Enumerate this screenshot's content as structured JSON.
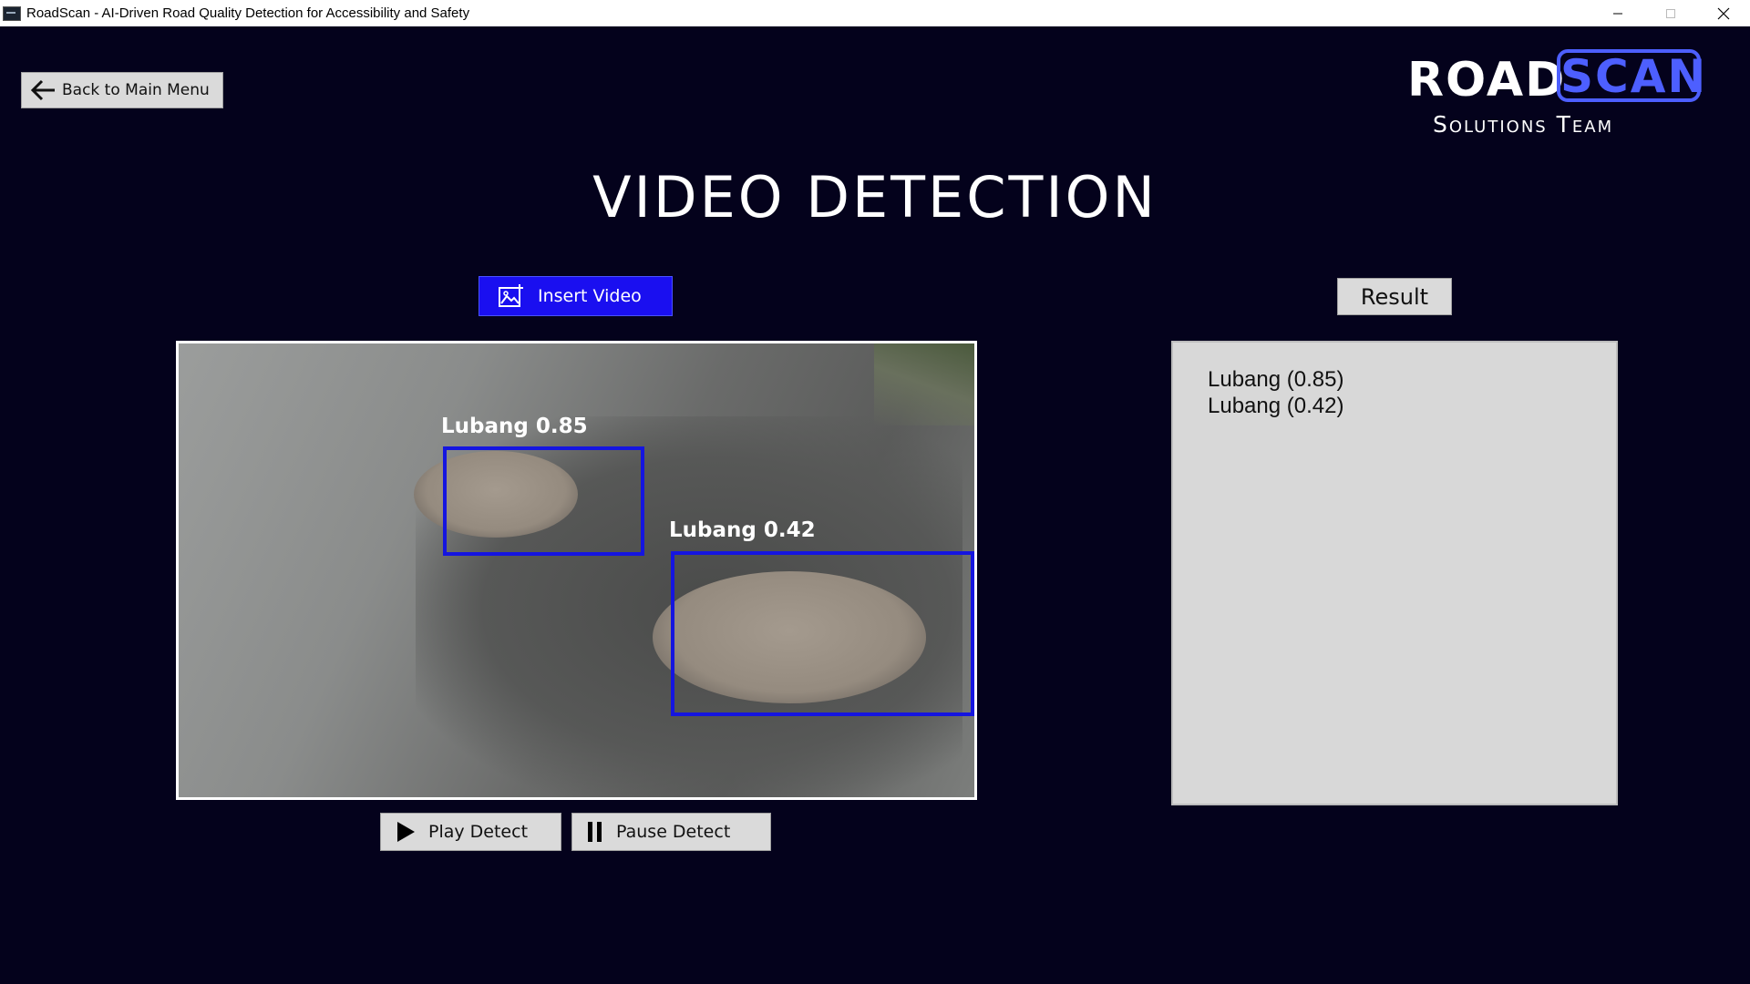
{
  "window": {
    "title": "RoadScan - AI-Driven Road Quality Detection for Accessibility and Safety"
  },
  "nav": {
    "back_label": "Back to Main Menu"
  },
  "logo": {
    "road": "ROAD",
    "scan": "SCAN",
    "subtitle": "Solutions Team"
  },
  "page": {
    "title": "VIDEO DETECTION"
  },
  "actions": {
    "insert_label": "Insert Video",
    "play_label": "Play Detect",
    "pause_label": "Pause Detect",
    "result_label": "Result"
  },
  "video": {
    "detections": [
      {
        "label": "Lubang 0.85"
      },
      {
        "label": "Lubang 0.42"
      }
    ]
  },
  "results": [
    "Lubang (0.85)",
    "Lubang (0.42)"
  ],
  "colors": {
    "background": "#04021c",
    "accent": "#1a0ff0",
    "box": "#1515e0",
    "logo_blue": "#4d5fff"
  },
  "icons": [
    "back-arrow-icon",
    "image-add-icon",
    "play-icon",
    "pause-icon"
  ]
}
